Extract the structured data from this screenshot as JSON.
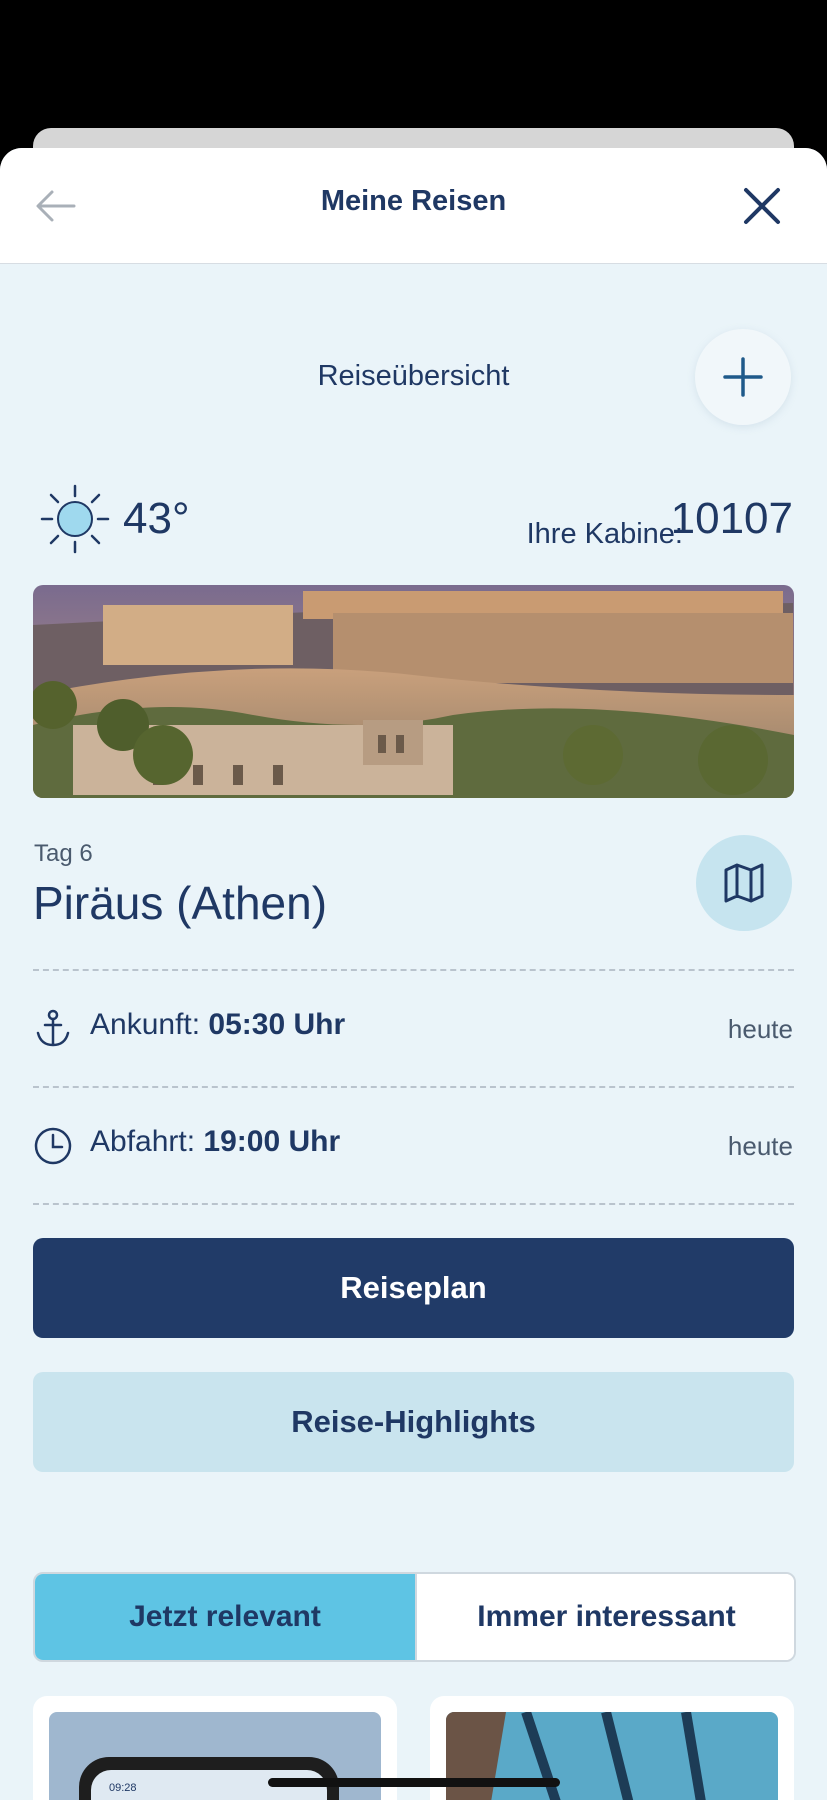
{
  "header": {
    "title": "Meine Reisen",
    "back_icon": "arrow-left-icon",
    "close_icon": "close-icon"
  },
  "overview": {
    "title": "Reiseübersicht",
    "add_icon": "plus-icon"
  },
  "weather": {
    "icon": "sun-icon",
    "temperature": "43°"
  },
  "cabin": {
    "label": "Ihre Kabine:",
    "number": "10107"
  },
  "destination": {
    "day": "Tag 6",
    "port": "Piräus (Athen)",
    "map_icon": "map-icon"
  },
  "arrival": {
    "label": "Ankunft:",
    "time": "05:30 Uhr",
    "when": "heute",
    "icon": "anchor-icon"
  },
  "departure": {
    "label": "Abfahrt:",
    "time": "19:00 Uhr",
    "when": "heute",
    "icon": "clock-icon"
  },
  "buttons": {
    "itinerary": "Reiseplan",
    "highlights": "Reise-Highlights"
  },
  "tabs": [
    {
      "label": "Jetzt relevant",
      "active": true
    },
    {
      "label": "Immer interessant",
      "active": false
    }
  ],
  "card_preview": {
    "time": "09:28"
  },
  "colors": {
    "navy": "#213b68",
    "accent_tab": "#5ec4e4",
    "secondary_button": "#c9e4ee",
    "page_background": "#eaf4f9"
  }
}
